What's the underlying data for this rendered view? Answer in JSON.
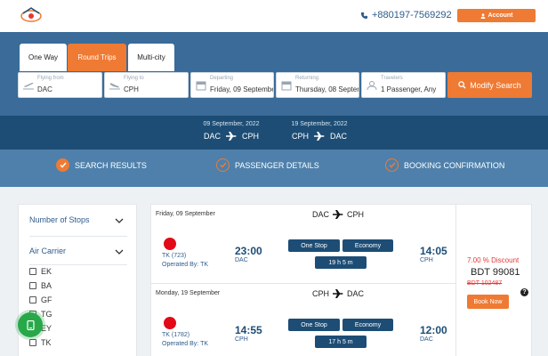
{
  "header": {
    "phone": "+880197-7569292",
    "account_label": "Account"
  },
  "search": {
    "tabs": [
      {
        "label": "One Way",
        "active": false
      },
      {
        "label": "Round Trips",
        "active": true
      },
      {
        "label": "Multi-city",
        "active": false
      }
    ],
    "fields": {
      "from": {
        "label": "Flying from",
        "value": "DAC"
      },
      "to": {
        "label": "Flying to",
        "value": "CPH"
      },
      "departing": {
        "label": "Departing",
        "value": "Friday, 09 Septembe"
      },
      "returning": {
        "label": "Returning",
        "value": "Thursday, 08 Septen"
      },
      "travelers": {
        "label": "Travelers",
        "value": "1 Passenger, Any"
      }
    },
    "modify_label": "Modify Search"
  },
  "route_bar": {
    "outbound": {
      "date": "09 September, 2022",
      "from": "DAC",
      "to": "CPH"
    },
    "inbound": {
      "date": "19 September, 2022",
      "from": "CPH",
      "to": "DAC"
    }
  },
  "steps": [
    {
      "label": "SEARCH RESULTS",
      "state": "done"
    },
    {
      "label": "PASSENGER DETAILS",
      "state": "pending"
    },
    {
      "label": "BOOKING CONFIRMATION",
      "state": "pending"
    }
  ],
  "filters": {
    "stops_title": "Number of Stops",
    "carrier_title": "Air Carrier",
    "carriers": [
      "EK",
      "BA",
      "GF",
      "TG",
      "EY",
      "TK"
    ]
  },
  "result": {
    "legs": [
      {
        "date": "Friday, 09 September",
        "route_from": "DAC",
        "route_to": "CPH",
        "flight_no": "TK (723)",
        "operated_by": "Operated By: TK",
        "dep_time": "23:00",
        "dep_code": "DAC",
        "arr_time": "14:05",
        "arr_code": "CPH",
        "stops": "One Stop",
        "cabin": "Economy",
        "duration": "19 h 5 m"
      },
      {
        "date": "Monday, 19 September",
        "route_from": "CPH",
        "route_to": "DAC",
        "flight_no": "TK (1782)",
        "operated_by": "Operated By: TK",
        "dep_time": "14:55",
        "dep_code": "CPH",
        "arr_time": "12:00",
        "arr_code": "DAC",
        "stops": "One Stop",
        "cabin": "Economy",
        "duration": "17 h 5 m"
      }
    ],
    "price": {
      "discount": "7.00 % Discount",
      "current": "BDT 99081",
      "original": "BDT 102487",
      "book_label": "Book Now",
      "help_glyph": "?"
    }
  },
  "colors": {
    "primary": "#1d4d75",
    "accent": "#ef7a33",
    "search_bg": "#3a6b99",
    "steps_bg": "#4e80ab"
  }
}
